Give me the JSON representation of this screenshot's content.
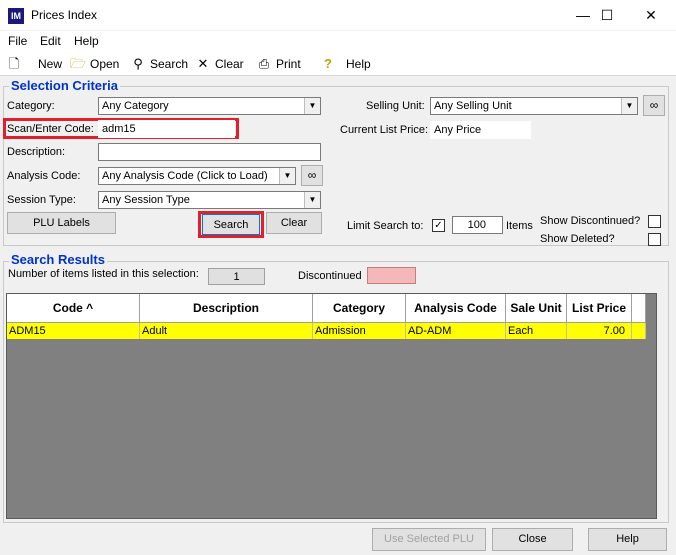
{
  "window": {
    "title": "Prices Index",
    "icon_text": "IM",
    "minimize_icon": "—",
    "maximize_icon": "☐",
    "close_icon": "✕"
  },
  "menu": [
    "File",
    "Edit",
    "Help"
  ],
  "toolbar": {
    "new": "New",
    "open": "Open",
    "search": "Search",
    "clear": "Clear",
    "print": "Print",
    "help": "Help"
  },
  "criteria": {
    "title": "Selection Criteria",
    "category_label": "Category:",
    "category_value": "Any Category",
    "scan_label": "Scan/Enter Code:",
    "scan_value": "adm15",
    "description_label": "Description:",
    "description_value": "",
    "analysis_label": "Analysis Code:",
    "analysis_value": "Any Analysis Code (Click to Load)",
    "session_label": "Session Type:",
    "session_value": "Any Session Type",
    "selling_unit_label": "Selling Unit:",
    "selling_unit_value": "Any Selling Unit",
    "list_price_label": "Current List Price:",
    "list_price_value": "Any Price",
    "plu_labels_button": "PLU Labels",
    "search_button": "Search",
    "clear_button": "Clear",
    "limit_label": "Limit Search to:",
    "limit_checked": true,
    "limit_value": "100",
    "items_label": "Items",
    "show_discontinued_label": "Show Discontinued?",
    "show_discontinued_checked": false,
    "show_deleted_label": "Show Deleted?",
    "show_deleted_checked": false
  },
  "results": {
    "title": "Search Results",
    "count_label": "Number of items listed in this selection:",
    "count_value": "1",
    "discontinued_label": "Discontinued",
    "discontinued_color": "#f4b8b8",
    "row_highlight_color": "#ffff00",
    "columns": [
      "Code ^",
      "Description",
      "Category",
      "Analysis Code",
      "Sale Unit",
      "List Price"
    ],
    "rows": [
      [
        "ADM15",
        "Adult",
        "Admission",
        "AD-ADM",
        "Each",
        "7.00"
      ]
    ]
  },
  "footer": {
    "use_selected": "Use Selected PLU",
    "close": "Close",
    "help": "Help"
  },
  "icons": {
    "binoculars": "🔍",
    "combo_arrow": "▼",
    "checkmark": "✓"
  }
}
